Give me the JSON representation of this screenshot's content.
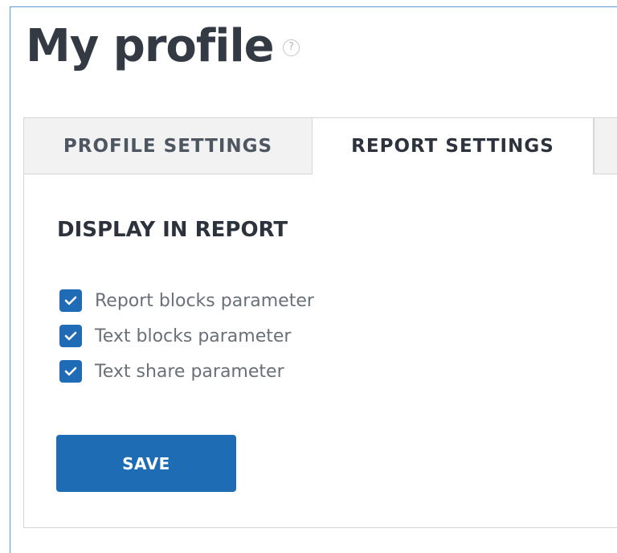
{
  "header": {
    "title": "My profile",
    "help_glyph": "?"
  },
  "tabs": [
    {
      "label": "PROFILE SETTINGS",
      "active": false
    },
    {
      "label": "REPORT SETTINGS",
      "active": true
    }
  ],
  "report_settings": {
    "heading": "DISPLAY IN REPORT",
    "options": [
      {
        "label": "Report blocks parameter",
        "checked": true
      },
      {
        "label": "Text blocks parameter",
        "checked": true
      },
      {
        "label": "Text share parameter",
        "checked": true
      }
    ],
    "save_label": "SAVE"
  },
  "icons": {
    "help": "question-circle-icon",
    "check": "checkmark-icon"
  },
  "colors": {
    "accent": "#1e6cb3",
    "title_text": "#333a44",
    "tab_inactive_bg": "#f2f2f2",
    "frame_border": "#5b9bd5"
  }
}
